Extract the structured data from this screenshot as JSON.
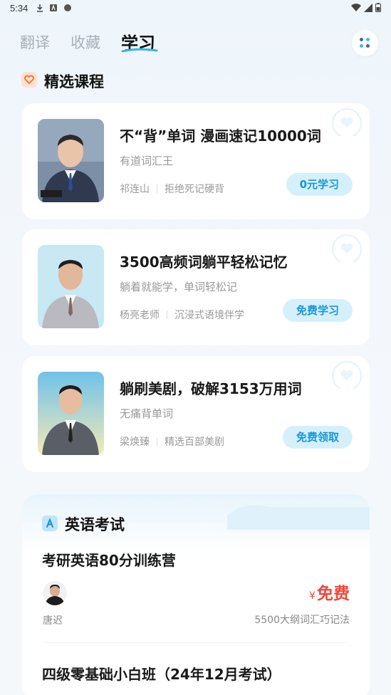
{
  "status_bar": {
    "time": "5:34"
  },
  "tabs": [
    {
      "label": "翻译",
      "active": false
    },
    {
      "label": "收藏",
      "active": false
    },
    {
      "label": "学习",
      "active": true
    }
  ],
  "featured": {
    "title": "精选课程",
    "courses": [
      {
        "title": "不“背”单词 漫画速记10000词",
        "subtitle": "有道词汇王",
        "teacher": "祁连山",
        "tag": "拒绝死记硬背",
        "button": "0元学习"
      },
      {
        "title": "3500高频词躺平轻松记忆",
        "subtitle": "躺着就能学，单词轻松记",
        "teacher": "杨亮老师",
        "tag": "沉浸式语境伴学",
        "button": "免费学习"
      },
      {
        "title": "躺刷美剧，破解3153万用词",
        "subtitle": "无痛背单词",
        "teacher": "梁焕臻",
        "tag": "精选百部美剧",
        "button": "免费领取"
      }
    ]
  },
  "exam": {
    "title": "英语考试",
    "courses": [
      {
        "title": "考研英语80分训练营",
        "teacher": "唐迟",
        "currency": "¥",
        "price": "免费",
        "desc": "5500大纲词汇巧记法"
      },
      {
        "title": "四级零基础小白班（24年12月考试）"
      }
    ]
  },
  "colors": {
    "accent": "#1897d8",
    "button_bg": "#d6f0fb",
    "price": "#f0473a"
  }
}
